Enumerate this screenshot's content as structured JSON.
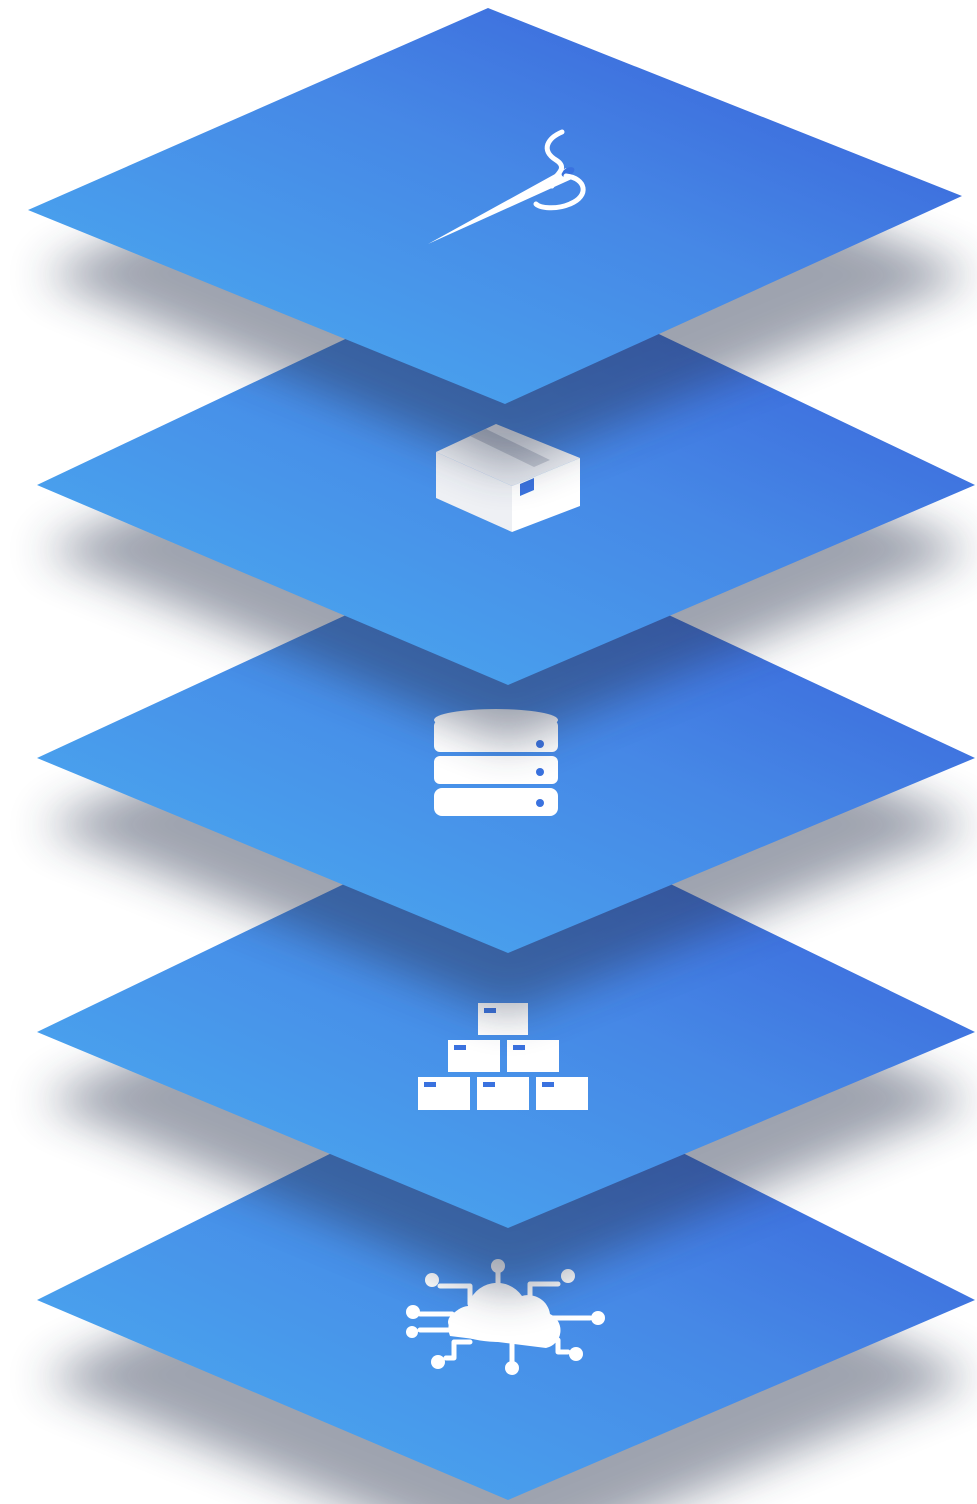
{
  "diagram": {
    "colors": {
      "layer_light": "#4aa6ef",
      "layer_dark": "#3764d8",
      "icon": "#ffffff",
      "shadow": "#1b2a55"
    },
    "layers": [
      {
        "icon": "needle-thread-icon"
      },
      {
        "icon": "package-box-icon"
      },
      {
        "icon": "database-icon"
      },
      {
        "icon": "stacked-boxes-icon"
      },
      {
        "icon": "cloud-network-icon"
      }
    ]
  }
}
